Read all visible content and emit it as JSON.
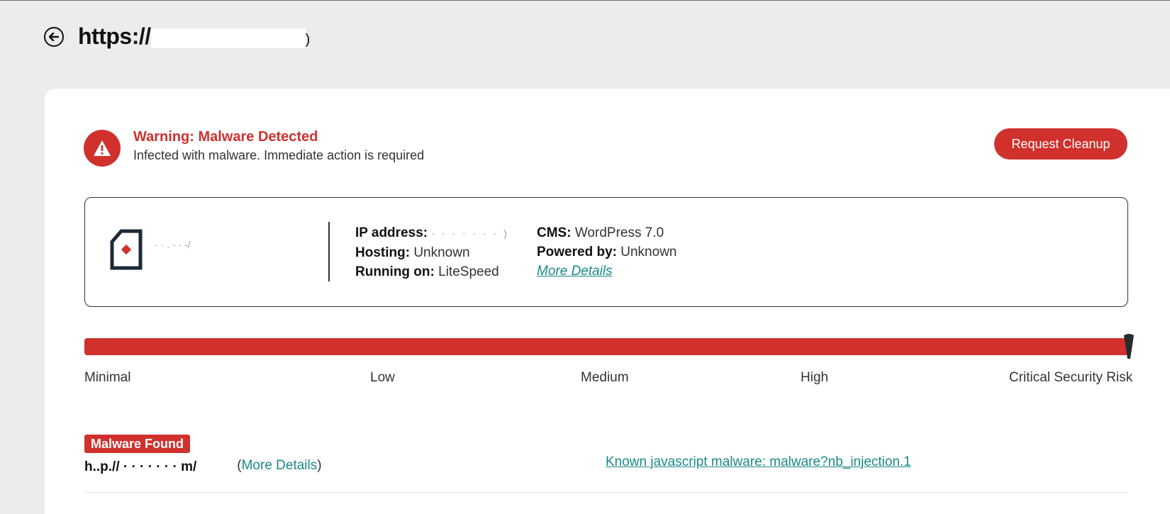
{
  "header": {
    "back_icon": "arrow-left-circle-icon",
    "url_prefix": "https://",
    "url_hidden_tail": ")"
  },
  "warning": {
    "icon": "warning-triangle-icon",
    "title": "Warning: Malware Detected",
    "subtitle": "Infected with malware. Immediate action is required"
  },
  "actions": {
    "request_cleanup": "Request Cleanup"
  },
  "site_info": {
    "site_icon": "sucuri-site-icon",
    "site_name_obscured": "· · .   ·   ·  -/",
    "ip_label": "IP address:",
    "ip_value": "· · · · · · · )",
    "hosting_label": "Hosting:",
    "hosting_value": "Unknown",
    "running_label": "Running on:",
    "running_value": "LiteSpeed",
    "cms_label": "CMS:",
    "cms_value": "WordPress 7.0",
    "powered_label": "Powered by:",
    "powered_value": "Unknown",
    "more_details": "More Details"
  },
  "risk": {
    "level": 1.0,
    "marker_icon": "pointer-marker-icon",
    "labels": [
      "Minimal",
      "Low",
      "Medium",
      "High",
      "Critical Security Risk"
    ],
    "bar_color": "#d0312d"
  },
  "findings": {
    "badge": "Malware Found",
    "url_obscured": "h..p.// · · · · · · · m/",
    "paren_open": "(",
    "more_details": "More Details",
    "paren_close": ")",
    "malware_link": "Known javascript malware: malware?nb_injection.1"
  },
  "colors": {
    "accent_red": "#d0312d",
    "link_teal": "#1a8a87",
    "page_bg": "#ececec"
  }
}
